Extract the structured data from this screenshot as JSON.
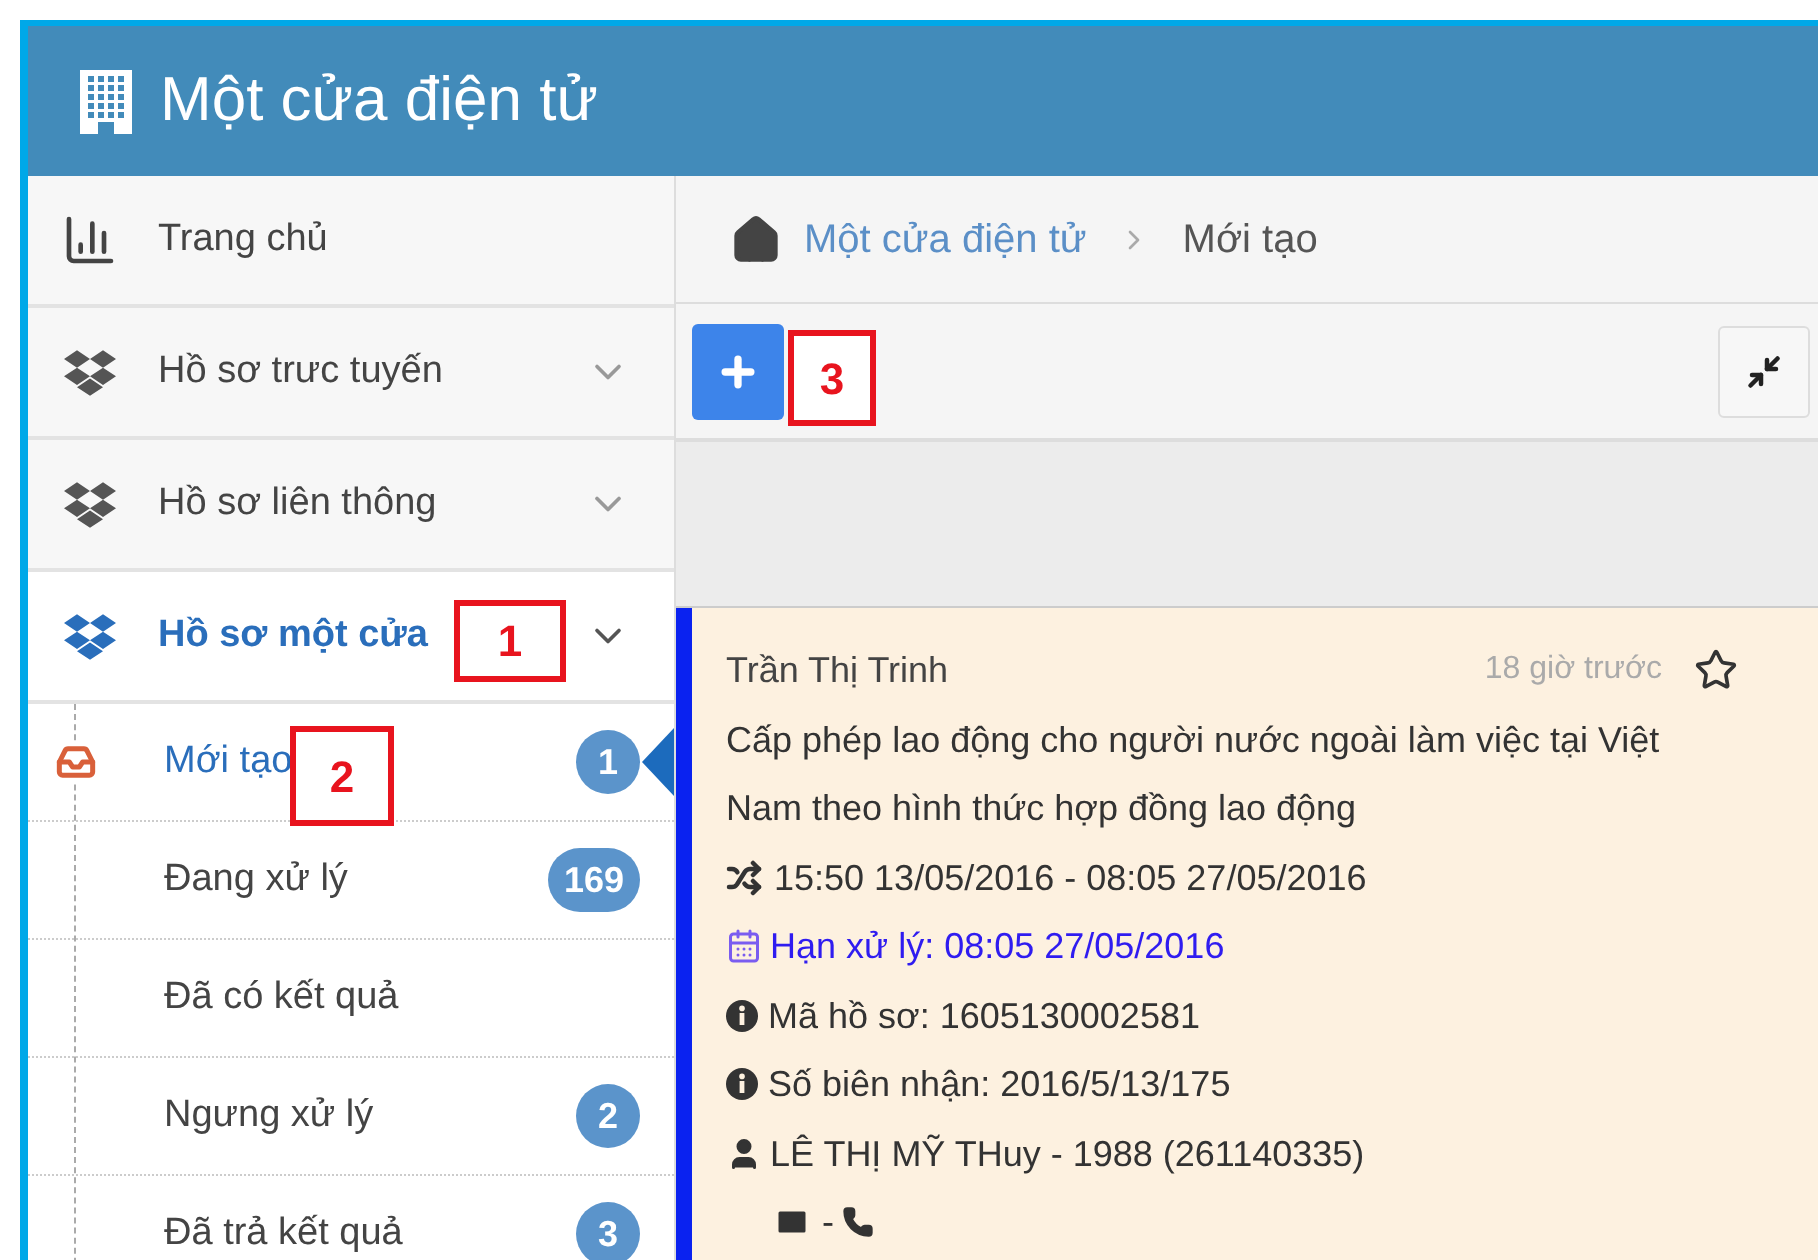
{
  "header": {
    "title": "Một cửa điện tử"
  },
  "sidebar": {
    "items": [
      {
        "kind": "chart",
        "label": "Trang chủ",
        "selected": false
      },
      {
        "kind": "box",
        "label": "Hồ sơ trưc tuyến",
        "selected": false,
        "expanded": false
      },
      {
        "kind": "box",
        "label": "Hồ sơ liên thông",
        "selected": false,
        "expanded": false
      },
      {
        "kind": "box",
        "label": "Hồ sơ một cửa",
        "selected": true,
        "expanded": true,
        "children": [
          {
            "label": "Mới tạo",
            "badge": "1",
            "selected": true
          },
          {
            "label": "Đang xử lý",
            "badge": "169",
            "selected": false
          },
          {
            "label": "Đã có kết quả",
            "selected": false
          },
          {
            "label": "Ngưng xử lý",
            "badge": "2",
            "selected": false
          },
          {
            "label": "Đã trả kết quả",
            "badge": "3",
            "selected": false
          }
        ]
      }
    ]
  },
  "breadcrumb": [
    "Một cửa điện tử",
    "Mới tạo"
  ],
  "card": {
    "applicant": "Trần Thị Trinh",
    "time": "18 giờ trước",
    "starred": false,
    "title": "Cấp phép lao động cho người nước ngoài làm việc tại Việt Nam theo hình thức hợp đồng lao động",
    "period": "15:50 13/05/2016 - 08:05 27/05/2016",
    "deadline": "Hạn xử lý: 08:05 27/05/2016",
    "file_code": "Mã hồ sơ: 1605130002581",
    "receipt": "Số biên nhận: 2016/5/13/175",
    "person": "LÊ THỊ MỸ THuy - 1988 (261140335)",
    "contact_separator": "-"
  },
  "annotations": [
    {
      "label": "1"
    },
    {
      "label": "2"
    },
    {
      "label": "3"
    }
  ]
}
